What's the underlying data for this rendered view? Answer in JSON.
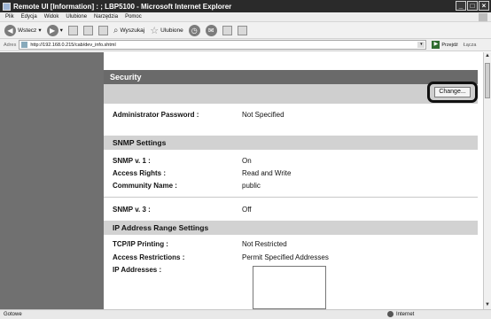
{
  "window": {
    "title": "Remote UI [Information] : ; LBP5100 - Microsoft Internet Explorer",
    "controls": [
      "_",
      "□",
      "×"
    ]
  },
  "menu": [
    "Plik",
    "Edycja",
    "Widok",
    "Ulubione",
    "Narzędzia",
    "Pomoc"
  ],
  "toolbar": {
    "back": "Wstecz",
    "search": "Wyszukaj",
    "favorites": "Ulubione"
  },
  "address": {
    "label": "Adres",
    "url": "http://192.168.0.215/cab/dev_info.shtml",
    "go": "Przejdź",
    "links": "Łącza"
  },
  "security": {
    "title": "Security",
    "change_button": "Change...",
    "admin_label": "Administrator Password :",
    "admin_value": "Not Specified"
  },
  "snmp": {
    "title": "SNMP Settings",
    "v1_label": "SNMP v. 1 :",
    "v1_value": "On",
    "rights_label": "Access Rights :",
    "rights_value": "Read and Write",
    "community_label": "Community Name :",
    "community_value": "public",
    "v3_label": "SNMP v. 3 :",
    "v3_value": "Off"
  },
  "ip_range": {
    "title": "IP Address Range Settings",
    "tcpip_label": "TCP/IP Printing :",
    "tcpip_value": "Not Restricted",
    "restrict_label": "Access Restrictions :",
    "restrict_value": "Permit Specified Addresses",
    "addresses_label": "IP Addresses :"
  },
  "status": {
    "left": "Gotowe",
    "zone": "Internet"
  }
}
